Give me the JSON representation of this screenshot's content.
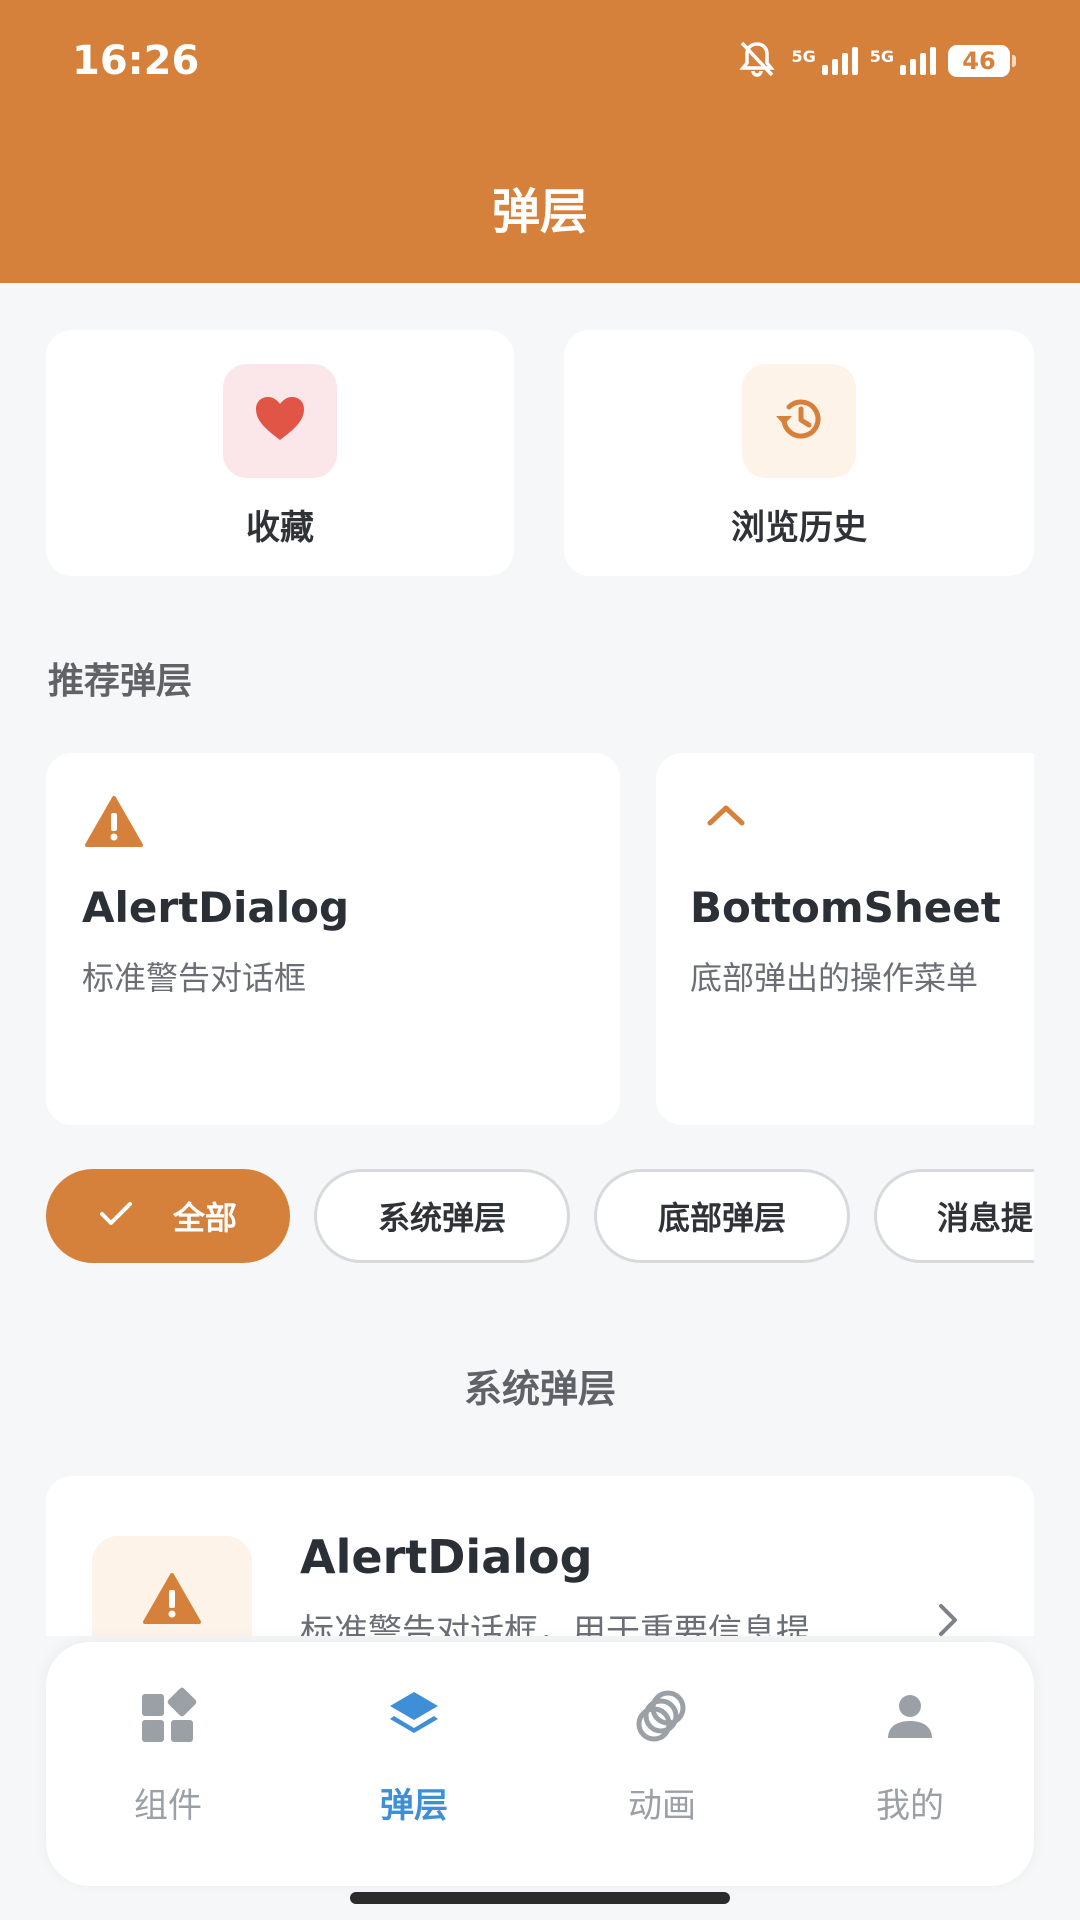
{
  "status_bar": {
    "time": "16:26",
    "network_1": "5G",
    "network_2": "5G",
    "battery": "46"
  },
  "header": {
    "title": "弹层"
  },
  "quick_actions": [
    {
      "label": "收藏",
      "icon": "heart-icon",
      "icon_color": "#e05546",
      "bg_color": "#fbe6ea"
    },
    {
      "label": "浏览历史",
      "icon": "history-icon",
      "icon_color": "#d6813b",
      "bg_color": "#fdf3e8"
    }
  ],
  "recommended": {
    "heading": "推荐弹层",
    "items": [
      {
        "title": "AlertDialog",
        "description": "标准警告对话框",
        "icon": "warning-icon"
      },
      {
        "title": "BottomSheet",
        "description": "底部弹出的操作菜单",
        "icon": "chevron-up-icon"
      }
    ]
  },
  "filters": {
    "selected": "全部",
    "chips": [
      "全部",
      "系统弹层",
      "底部弹层",
      "消息提"
    ]
  },
  "list": {
    "group_heading": "系统弹层",
    "items": [
      {
        "title": "AlertDialog",
        "description": "标准警告对话框，用于重要信息提",
        "icon": "warning-icon"
      }
    ]
  },
  "bottom_nav": {
    "active": "弹层",
    "items": [
      {
        "label": "组件",
        "icon": "widgets-icon"
      },
      {
        "label": "弹层",
        "icon": "layers-icon"
      },
      {
        "label": "动画",
        "icon": "animation-rings-icon"
      },
      {
        "label": "我的",
        "icon": "person-icon"
      }
    ]
  },
  "colors": {
    "accent": "#d6813b",
    "nav_active": "#3f8fd6",
    "nav_inactive": "#9aa0a6",
    "background": "#f6f7f9"
  }
}
